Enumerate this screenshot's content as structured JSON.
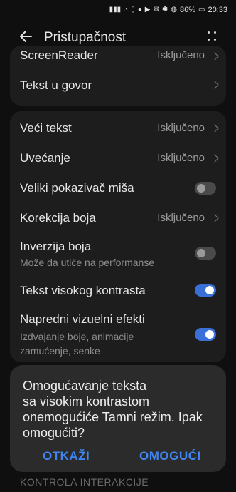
{
  "status": {
    "battery": "86%",
    "time": "20:33",
    "icons": [
      "signal-icon",
      "signal-icon",
      "wifi-icon",
      "nfc-icon",
      "notification-icon",
      "video-icon",
      "mail-icon",
      "bluetooth-icon",
      "mute-icon",
      "battery-icon"
    ]
  },
  "appbar": {
    "title": "Pristupačnost"
  },
  "card1": {
    "screenreader_label": "ScreenReader",
    "screenreader_value": "Isključeno",
    "tts_label": "Tekst u govor"
  },
  "card2": {
    "large_text_label": "Veći tekst",
    "large_text_value": "Isključeno",
    "magnify_label": "Uvećanje",
    "magnify_value": "Isključeno",
    "pointer_label": "Veliki pokazivač miša",
    "pointer_on": false,
    "color_correction_label": "Korekcija boja",
    "color_correction_value": "Isključeno",
    "color_inversion_label": "Inverzija boja",
    "color_inversion_sub": "Može da utiče na performanse",
    "color_inversion_on": false,
    "high_contrast_label": "Tekst visokog kontrasta",
    "high_contrast_on": true,
    "advanced_label": "Napredni vizuelni efekti",
    "advanced_sub1": "Izdvajanje boje, animacije",
    "advanced_sub2": "zamućenje, senke",
    "advanced_on": true
  },
  "dialog": {
    "message_line1": "Omogućavanje teksta",
    "message_line2": "sa visokim kontrastom",
    "message_line3": "onemogućiće Tamni režim. Ipak",
    "message_line4": "omogućiti?",
    "cancel": "OTKAŽI",
    "confirm": "OMOGUĆI"
  },
  "bottom_peek": "KONTROLA INTERAKCIJE",
  "colors": {
    "accent": "#3f86f2",
    "toggle_on": "#3a6fd8",
    "background": "#0f0f0f",
    "card": "#1d1d1d",
    "dialog": "#2b2b2b"
  }
}
